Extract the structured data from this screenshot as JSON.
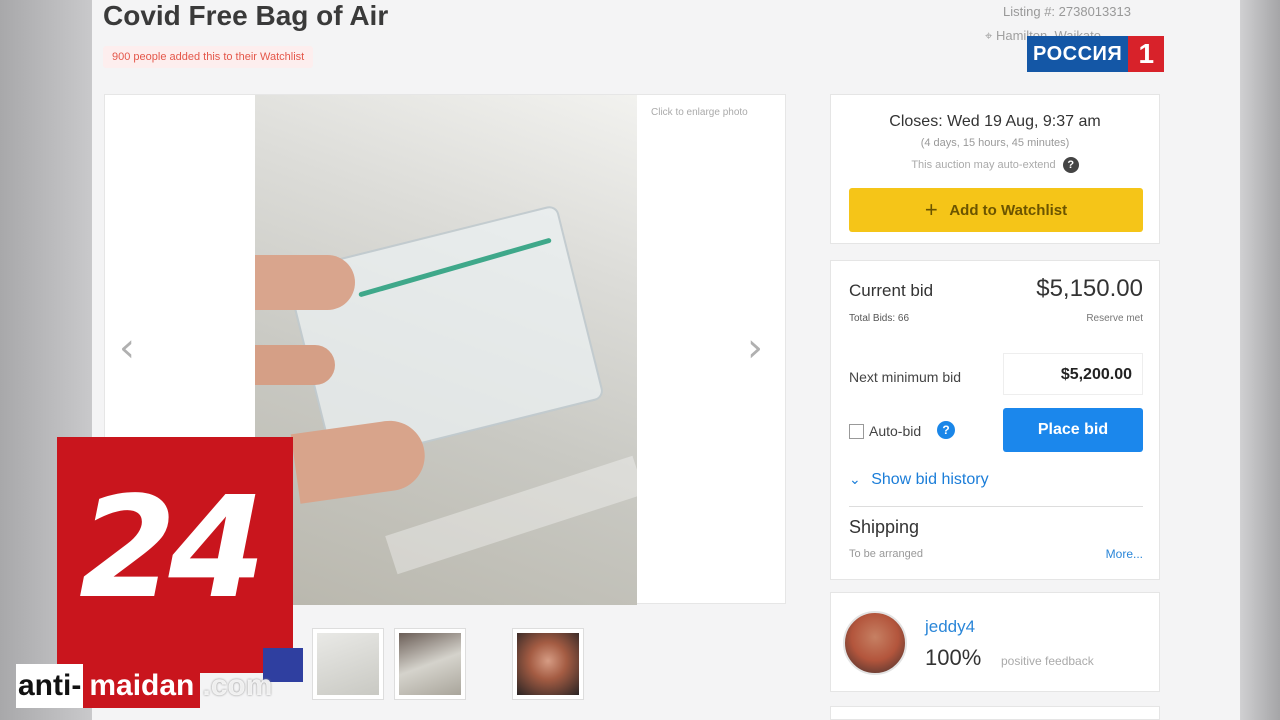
{
  "listing": {
    "title": "Covid Free Bag of Air",
    "watchlist_badge": "900 people added this to their Watchlist",
    "listing_number": "Listing #: 2738013313",
    "location": "Hamilton, Waikato"
  },
  "gallery": {
    "enlarge_hint": "Click to enlarge photo",
    "prev_arrow": "‹",
    "next_arrow": "›"
  },
  "auction": {
    "closes": "Closes: Wed 19 Aug, 9:37 am",
    "remaining": "(4 days, 15 hours, 45 minutes)",
    "auto_extend": "This auction may auto-extend",
    "help_glyph": "?",
    "watchlist_button": "Add to Watchlist",
    "plus_glyph": "+"
  },
  "bid": {
    "current_label": "Current bid",
    "current_value": "$5,150.00",
    "total_bids": "Total Bids: 66",
    "reserve": "Reserve met",
    "next_label": "Next minimum bid",
    "next_value": "$5,200.00",
    "autobid_label": "Auto-bid",
    "autobid_help": "?",
    "place_button": "Place bid",
    "history_chevron": "⌄",
    "history_link": "Show bid history",
    "shipping_label": "Shipping",
    "shipping_value": "To be arranged",
    "more_link": "More..."
  },
  "seller": {
    "name": "jeddy4",
    "feedback_percent": "100%",
    "feedback_label": "positive feedback"
  },
  "overlays": {
    "channel_word": "РОССИЯ",
    "channel_num": "1",
    "logo_24": "24",
    "wm_anti": "anti-",
    "wm_maidan": "maidan",
    "wm_com": ".com"
  },
  "colors": {
    "watchlist_yellow": "#f5c518",
    "place_bid_blue": "#1b87ec",
    "link_blue": "#2a86d8",
    "badge_red": "#e4574a",
    "rossiya_blue": "#1457a6",
    "accent_red": "#c9151d"
  }
}
